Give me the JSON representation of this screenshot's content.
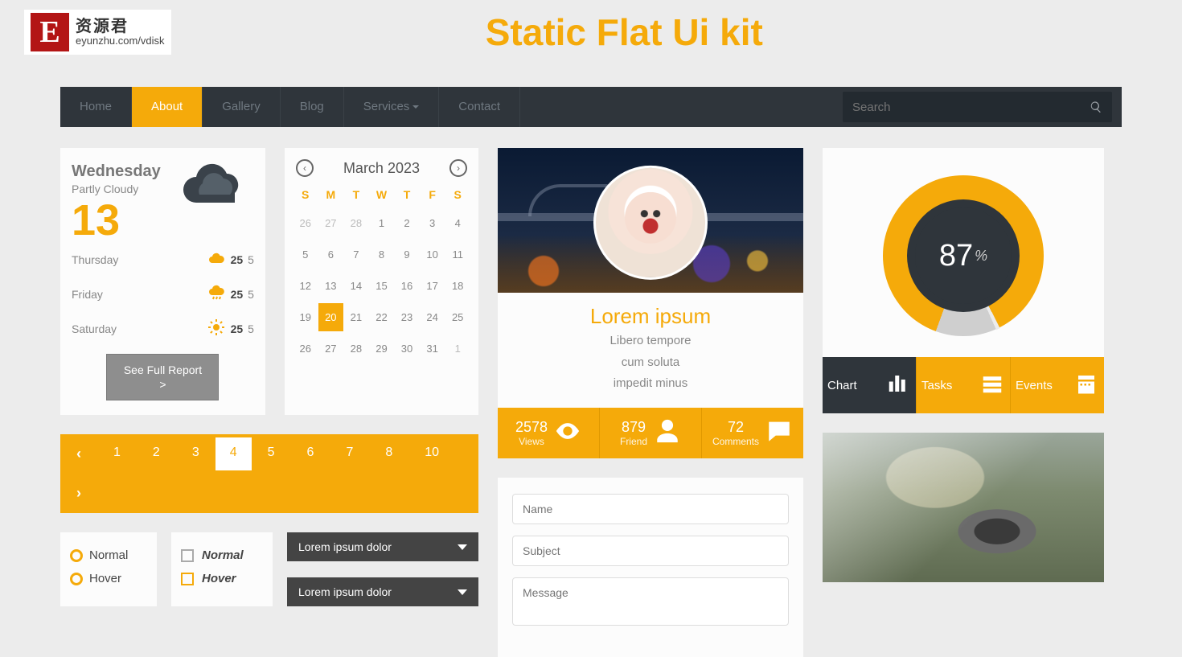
{
  "logo": {
    "letter": "E",
    "cn": "资源君",
    "url": "eyunzhu.com/vdisk"
  },
  "page_title": "Static Flat Ui kit",
  "nav": {
    "items": [
      "Home",
      "About",
      "Gallery",
      "Blog",
      "Services",
      "Contact"
    ],
    "active_index": 1,
    "dropdown_index": 4,
    "search_placeholder": "Search"
  },
  "weather": {
    "today_day": "Wednesday",
    "today_cond": "Partly Cloudy",
    "today_temp": "13",
    "forecast": [
      {
        "day": "Thursday",
        "icon": "cloud-up-icon",
        "hi": "25",
        "lo": "5"
      },
      {
        "day": "Friday",
        "icon": "cloud-rain-icon",
        "hi": "25",
        "lo": "5"
      },
      {
        "day": "Saturday",
        "icon": "sun-icon",
        "hi": "25",
        "lo": "5"
      }
    ],
    "button_label": "See Full Report >"
  },
  "calendar": {
    "title": "March 2023",
    "dow": [
      "S",
      "M",
      "T",
      "W",
      "T",
      "F",
      "S"
    ],
    "cells": [
      {
        "n": "26",
        "out": true
      },
      {
        "n": "27",
        "out": true
      },
      {
        "n": "28",
        "out": true
      },
      {
        "n": "1"
      },
      {
        "n": "2"
      },
      {
        "n": "3"
      },
      {
        "n": "4"
      },
      {
        "n": "5"
      },
      {
        "n": "6"
      },
      {
        "n": "7"
      },
      {
        "n": "8"
      },
      {
        "n": "9"
      },
      {
        "n": "10"
      },
      {
        "n": "11"
      },
      {
        "n": "12"
      },
      {
        "n": "13"
      },
      {
        "n": "14"
      },
      {
        "n": "15"
      },
      {
        "n": "16"
      },
      {
        "n": "17"
      },
      {
        "n": "18"
      },
      {
        "n": "19"
      },
      {
        "n": "20",
        "sel": true
      },
      {
        "n": "21"
      },
      {
        "n": "22"
      },
      {
        "n": "23"
      },
      {
        "n": "24"
      },
      {
        "n": "25"
      },
      {
        "n": "26"
      },
      {
        "n": "27"
      },
      {
        "n": "28"
      },
      {
        "n": "29"
      },
      {
        "n": "30"
      },
      {
        "n": "31"
      },
      {
        "n": "1",
        "out": true
      }
    ]
  },
  "pagination": {
    "pages": [
      "1",
      "2",
      "3",
      "4",
      "5",
      "6",
      "7",
      "8",
      "10"
    ],
    "active": "4"
  },
  "controls": {
    "radio": [
      "Normal",
      "Hover"
    ],
    "checkbox": [
      "Normal",
      "Hover"
    ],
    "dropdown1": "Lorem ipsum dolor",
    "dropdown2": "Lorem ipsum dolor"
  },
  "profile": {
    "name": "Lorem ipsum",
    "line1": "Libero tempore",
    "line2": "cum soluta",
    "line3": "impedit minus",
    "stats": [
      {
        "value": "2578",
        "label": "Views",
        "icon": "eye-icon"
      },
      {
        "value": "879",
        "label": "Friend",
        "icon": "user-icon"
      },
      {
        "value": "72",
        "label": "Comments",
        "icon": "comment-icon"
      }
    ]
  },
  "form": {
    "name_ph": "Name",
    "subject_ph": "Subject",
    "message_ph": "Message"
  },
  "donut": {
    "value": "87",
    "unit": "%",
    "tabs": [
      {
        "label": "Chart",
        "icon": "bars-icon"
      },
      {
        "label": "Tasks",
        "icon": "list-icon"
      },
      {
        "label": "Events",
        "icon": "calendar-icon"
      }
    ]
  },
  "colors": {
    "accent": "#f5aa0a",
    "navbar": "#2f353b"
  }
}
